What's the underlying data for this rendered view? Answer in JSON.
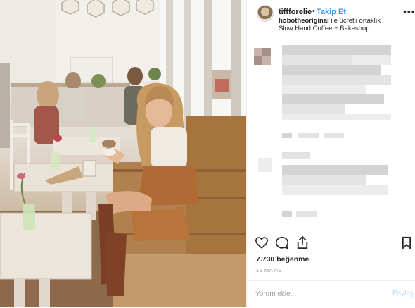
{
  "photo": {
    "alt": "Woman smiling holding a coffee cup in a bright cafe"
  },
  "header": {
    "username": "tiffforelie",
    "separator": "•",
    "follow_label": "Takip Et",
    "partner_name": "hobotheoriginal",
    "partner_suffix": " ile ücretli ortaklık",
    "location": "Slow Hand Coffee + Bakeshop",
    "more_icon": "more-horizontal-icon"
  },
  "actions": {
    "like_icon": "heart-icon",
    "comment_icon": "comment-icon",
    "share_icon": "share-icon",
    "save_icon": "bookmark-icon",
    "likes": "7.730 beğenme",
    "date": "15 MAYIS"
  },
  "comment": {
    "placeholder": "Yorum ekle...",
    "post_label": "Paylaş"
  },
  "colors": {
    "accent": "#3897f0",
    "post_disabled": "#b3dbff",
    "text": "#262626",
    "muted": "#999999"
  }
}
